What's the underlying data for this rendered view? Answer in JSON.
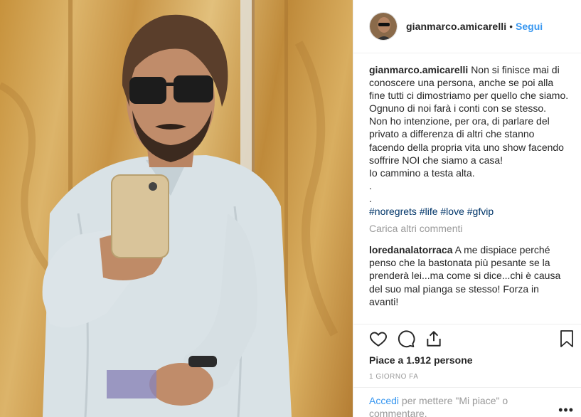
{
  "header": {
    "username": "gianmarco.amicarelli",
    "separator": "•",
    "follow_label": "Segui"
  },
  "caption": {
    "username": "gianmarco.amicarelli",
    "text": "Non si finisce mai di conoscere una persona, anche se poi alla fine tutti ci dimostriamo per quello che siamo.\nOgnuno di noi farà i conti con se stesso.\nNon ho intenzione, per ora, di parlare del privato a differenza di altri che stanno facendo della propria vita uno show facendo soffrire NOI che siamo a casa!\nIo cammino a testa alta.\n.\n.",
    "hashtags": "#noregrets #life #love #gfvip"
  },
  "load_more_label": "Carica altri commenti",
  "comments": [
    {
      "username": "loredanalatorraca",
      "text": "A me dispiace perché penso che la bastonata più pesante se la prenderà lei...ma come si dice...chi è causa del suo mal pianga se stesso! Forza in avanti!"
    }
  ],
  "actions": {
    "like_icon": "heart-icon",
    "comment_icon": "comment-icon",
    "share_icon": "share-icon",
    "save_icon": "bookmark-icon"
  },
  "likes_text": "Piace a 1.912 persone",
  "timestamp": "1 GIORNO FA",
  "login": {
    "link_label": "Accedi",
    "text": " per mettere \"Mi piace\" o commentare."
  },
  "more_icon": "ellipsis-icon",
  "colors": {
    "link_blue": "#3897f0",
    "hashtag_blue": "#003569",
    "muted_gray": "#999999",
    "text_dark": "#262626"
  }
}
